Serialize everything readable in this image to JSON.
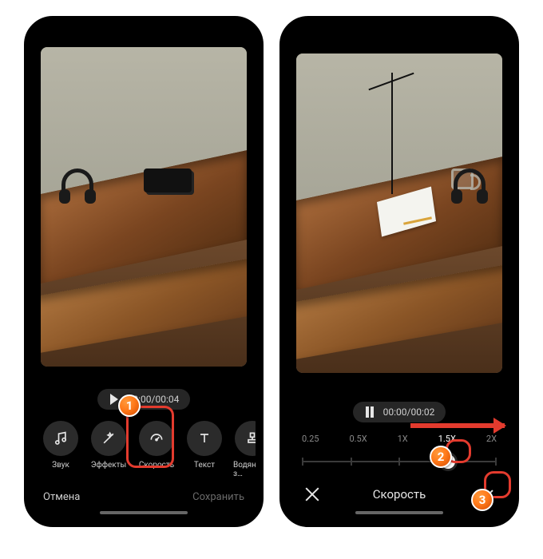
{
  "screen1": {
    "timecode": "00:00/00:04",
    "tools": {
      "sound": {
        "label": "Звук"
      },
      "effects": {
        "label": "Эффекты"
      },
      "speed": {
        "label": "Скорость"
      },
      "text": {
        "label": "Текст"
      },
      "watermark": {
        "label": "Водяной з…"
      }
    },
    "footer": {
      "cancel": "Отмена",
      "save": "Сохранить"
    }
  },
  "screen2": {
    "timecode": "00:00/00:02",
    "speed": {
      "options": [
        "0.25",
        "0.5X",
        "1X",
        "1.5X",
        "2X"
      ],
      "selected_index": 3,
      "knob_percent": 75
    },
    "title": "Скорость"
  },
  "annotations": {
    "badge1": "1",
    "badge2": "2",
    "badge3": "3"
  }
}
